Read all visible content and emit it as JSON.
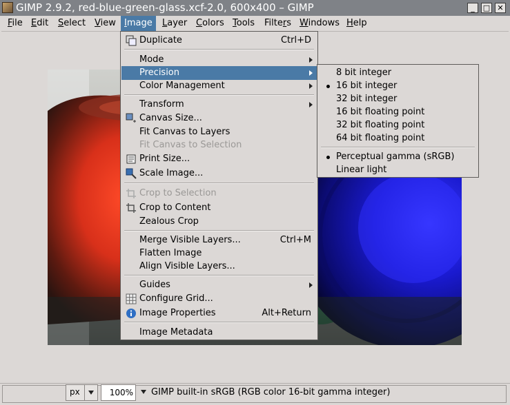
{
  "window": {
    "title": "GIMP 2.9.2, red-blue-green-glass.xcf-2.0, 600x400 – GIMP",
    "minimize": "_",
    "maximize": "□",
    "close": "✕"
  },
  "menubar": {
    "items": [
      {
        "label": "File"
      },
      {
        "label": "Edit"
      },
      {
        "label": "Select"
      },
      {
        "label": "View"
      },
      {
        "label": "Image"
      },
      {
        "label": "Layer"
      },
      {
        "label": "Colors"
      },
      {
        "label": "Tools"
      },
      {
        "label": "Filters"
      },
      {
        "label": "Windows"
      },
      {
        "label": "Help"
      }
    ]
  },
  "image_menu": {
    "items": [
      {
        "label": "Duplicate",
        "accel": "Ctrl+D",
        "icon": "duplicate-icon"
      },
      {
        "label": "Mode"
      },
      {
        "label": "Precision"
      },
      {
        "label": "Color Management"
      },
      {
        "label": "Transform"
      },
      {
        "label": "Canvas Size...",
        "icon": "canvas-size-icon"
      },
      {
        "label": "Fit Canvas to Layers"
      },
      {
        "label": "Fit Canvas to Selection"
      },
      {
        "label": "Print Size...",
        "icon": "print-size-icon"
      },
      {
        "label": "Scale Image...",
        "icon": "scale-icon"
      },
      {
        "label": "Crop to Selection",
        "icon": "crop-icon"
      },
      {
        "label": "Crop to Content",
        "icon": "crop-icon"
      },
      {
        "label": "Zealous Crop"
      },
      {
        "label": "Merge Visible Layers...",
        "accel": "Ctrl+M"
      },
      {
        "label": "Flatten Image"
      },
      {
        "label": "Align Visible Layers..."
      },
      {
        "label": "Guides"
      },
      {
        "label": "Configure Grid...",
        "icon": "grid-icon"
      },
      {
        "label": "Image Properties",
        "accel": "Alt+Return",
        "icon": "info-icon"
      },
      {
        "label": "Image Metadata"
      }
    ]
  },
  "precision_menu": {
    "items": [
      {
        "label": "8 bit integer"
      },
      {
        "label": "16 bit integer",
        "selected": true
      },
      {
        "label": "32 bit integer"
      },
      {
        "label": "16 bit floating point"
      },
      {
        "label": "32 bit floating point"
      },
      {
        "label": "64 bit floating point"
      },
      {
        "label": "Perceptual gamma (sRGB)",
        "selected": true
      },
      {
        "label": "Linear light"
      }
    ]
  },
  "statusbar": {
    "unit": "px",
    "zoom": "100%",
    "info": "GIMP built-in sRGB (RGB color 16-bit gamma integer)"
  },
  "colors": {
    "highlight": "#4a7aa6",
    "background": "#dcd8d6",
    "titlebar": "#7f8287"
  }
}
